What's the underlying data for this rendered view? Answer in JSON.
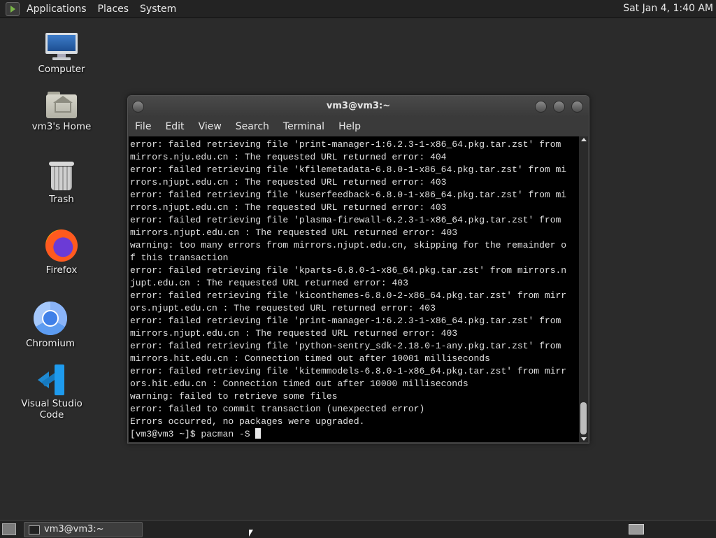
{
  "top_panel": {
    "menus": [
      "Applications",
      "Places",
      "System"
    ],
    "clock": "Sat Jan  4,  1:40 AM"
  },
  "desktop": {
    "icons": [
      {
        "label": "Computer",
        "icon": "computer-icon"
      },
      {
        "label": "vm3's Home",
        "icon": "home-folder-icon"
      },
      {
        "label": "Trash",
        "icon": "trash-icon"
      },
      {
        "label": "Firefox",
        "icon": "firefox-icon"
      },
      {
        "label": "Chromium",
        "icon": "chromium-icon"
      },
      {
        "label": "Visual Studio Code",
        "icon": "vscode-icon"
      }
    ]
  },
  "terminal": {
    "title": "vm3@vm3:~",
    "menus": [
      "File",
      "Edit",
      "View",
      "Search",
      "Terminal",
      "Help"
    ],
    "lines": [
      "error: failed retrieving file 'print-manager-1:6.2.3-1-x86_64.pkg.tar.zst' from",
      "mirrors.nju.edu.cn : The requested URL returned error: 404",
      "error: failed retrieving file 'kfilemetadata-6.8.0-1-x86_64.pkg.tar.zst' from mi",
      "rrors.njupt.edu.cn : The requested URL returned error: 403",
      "error: failed retrieving file 'kuserfeedback-6.8.0-1-x86_64.pkg.tar.zst' from mi",
      "rrors.njupt.edu.cn : The requested URL returned error: 403",
      "error: failed retrieving file 'plasma-firewall-6.2.3-1-x86_64.pkg.tar.zst' from",
      "mirrors.njupt.edu.cn : The requested URL returned error: 403",
      "warning: too many errors from mirrors.njupt.edu.cn, skipping for the remainder o",
      "f this transaction",
      "error: failed retrieving file 'kparts-6.8.0-1-x86_64.pkg.tar.zst' from mirrors.n",
      "jupt.edu.cn : The requested URL returned error: 403",
      "error: failed retrieving file 'kiconthemes-6.8.0-2-x86_64.pkg.tar.zst' from mirr",
      "ors.njupt.edu.cn : The requested URL returned error: 403",
      "error: failed retrieving file 'print-manager-1:6.2.3-1-x86_64.pkg.tar.zst' from",
      "mirrors.njupt.edu.cn : The requested URL returned error: 403",
      "error: failed retrieving file 'python-sentry_sdk-2.18.0-1-any.pkg.tar.zst' from",
      "mirrors.hit.edu.cn : Connection timed out after 10001 milliseconds",
      "error: failed retrieving file 'kitemmodels-6.8.0-1-x86_64.pkg.tar.zst' from mirr",
      "ors.hit.edu.cn : Connection timed out after 10000 milliseconds",
      "warning: failed to retrieve some files",
      "error: failed to commit transaction (unexpected error)",
      "Errors occurred, no packages were upgraded."
    ],
    "prompt": "[vm3@vm3 ~]$ pacman -S "
  },
  "taskbar": {
    "window_label": "vm3@vm3:~"
  }
}
